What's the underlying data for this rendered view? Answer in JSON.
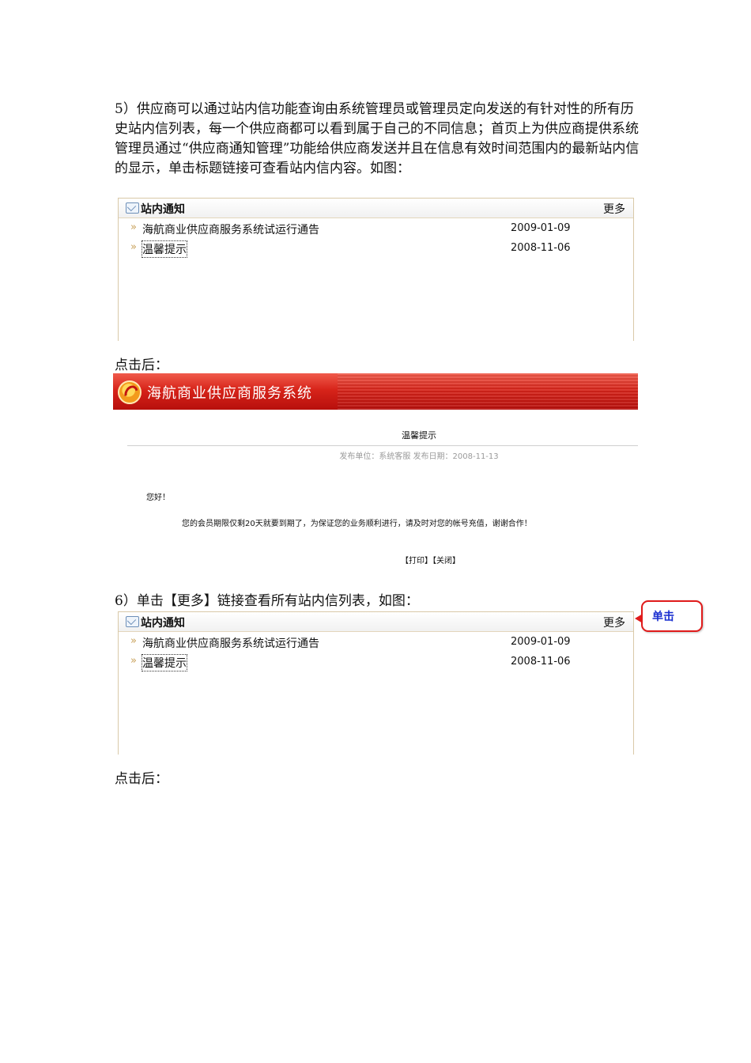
{
  "section5": {
    "paragraph": "5）供应商可以通过站内信功能查询由系统管理员或管理员定向发送的有针对性的所有历史站内信列表，每一个供应商都可以看到属于自己的不同信息；首页上为供应商提供系统管理员通过“供应商通知管理”功能给供应商发送并且在信息有效时间范围内的最新站内信的显示，单击标题链接可查看站内信内容。如图：",
    "after_click": "点击后："
  },
  "panel": {
    "title": "站内通知",
    "more": "更多",
    "bullet": "»",
    "items": [
      {
        "title": "海航商业供应商服务系统试运行通告",
        "date": "2009-01-09"
      },
      {
        "title": "温馨提示",
        "date": "2008-11-06"
      }
    ]
  },
  "message_page": {
    "system_name": "海航商业供应商服务系统",
    "title": "温馨提示",
    "meta": "发布单位：系统客服  发布日期：2008-11-13",
    "greeting": "您好！",
    "body": "您的会员期限仅剩20天就要到期了，为保证您的业务顺利进行，请及时对您的帐号充值，谢谢合作！",
    "print": "【打印】",
    "close": "【关闭】"
  },
  "section6": {
    "paragraph": "6）单击【更多】链接查看所有站内信列表，如图：",
    "callout": "单击",
    "after_click": "点击后："
  }
}
